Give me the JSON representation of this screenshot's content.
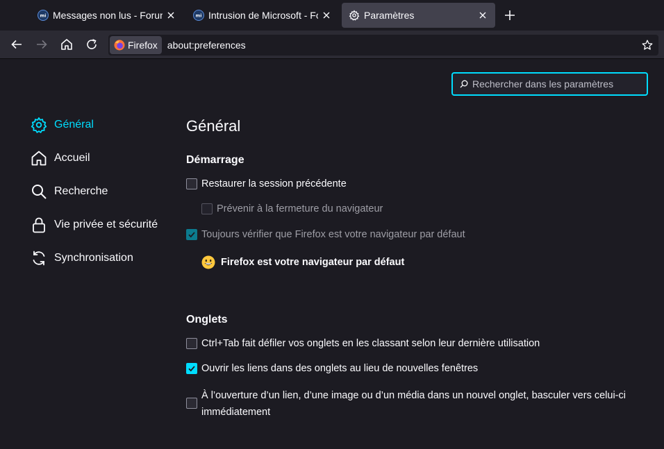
{
  "tabs": [
    {
      "title": "Messages non lus - Forum",
      "icon": "mi-forum-icon"
    },
    {
      "title": "Intrusion de Microsoft - Forum",
      "icon": "mi-forum-icon"
    },
    {
      "title": "Paramètres",
      "icon": "gear-icon"
    }
  ],
  "urlbar": {
    "identity_label": "Firefox",
    "url": "about:preferences"
  },
  "search": {
    "placeholder": "Rechercher dans les paramètres"
  },
  "sidebar": {
    "items": [
      {
        "label": "Général",
        "icon": "gear-icon",
        "selected": true
      },
      {
        "label": "Accueil",
        "icon": "home-icon"
      },
      {
        "label": "Recherche",
        "icon": "search-icon"
      },
      {
        "label": "Vie privée et sécurité",
        "icon": "lock-icon"
      },
      {
        "label": "Synchronisation",
        "icon": "sync-icon"
      }
    ]
  },
  "main": {
    "title": "Général",
    "startup": {
      "heading": "Démarrage",
      "restore_session": {
        "label": "Restaurer la session précédente",
        "checked": false
      },
      "warn_on_close": {
        "label": "Prévenir à la fermeture du navigateur",
        "checked": false
      },
      "check_default": {
        "label": "Toujours vérifier que Firefox est votre navigateur par défaut",
        "checked": true
      },
      "default_message": "Firefox est votre navigateur par défaut"
    },
    "tabs_section": {
      "heading": "Onglets",
      "ctrl_tab": {
        "label": "Ctrl+Tab fait défiler vos onglets en les classant selon leur dernière utilisation",
        "checked": false
      },
      "open_links_in_tabs": {
        "label": "Ouvrir les liens dans des onglets au lieu de nouvelles fenêtres",
        "checked": true
      },
      "switch_to_new_tab": {
        "label": "À l’ouverture d’un lien, d’une image ou d’un média dans un nouvel onglet, basculer vers celui-ci immédiatement",
        "checked": false
      }
    }
  },
  "colors": {
    "accent": "#00ddff",
    "background": "#1c1b22",
    "toolbar": "#2b2a33"
  }
}
